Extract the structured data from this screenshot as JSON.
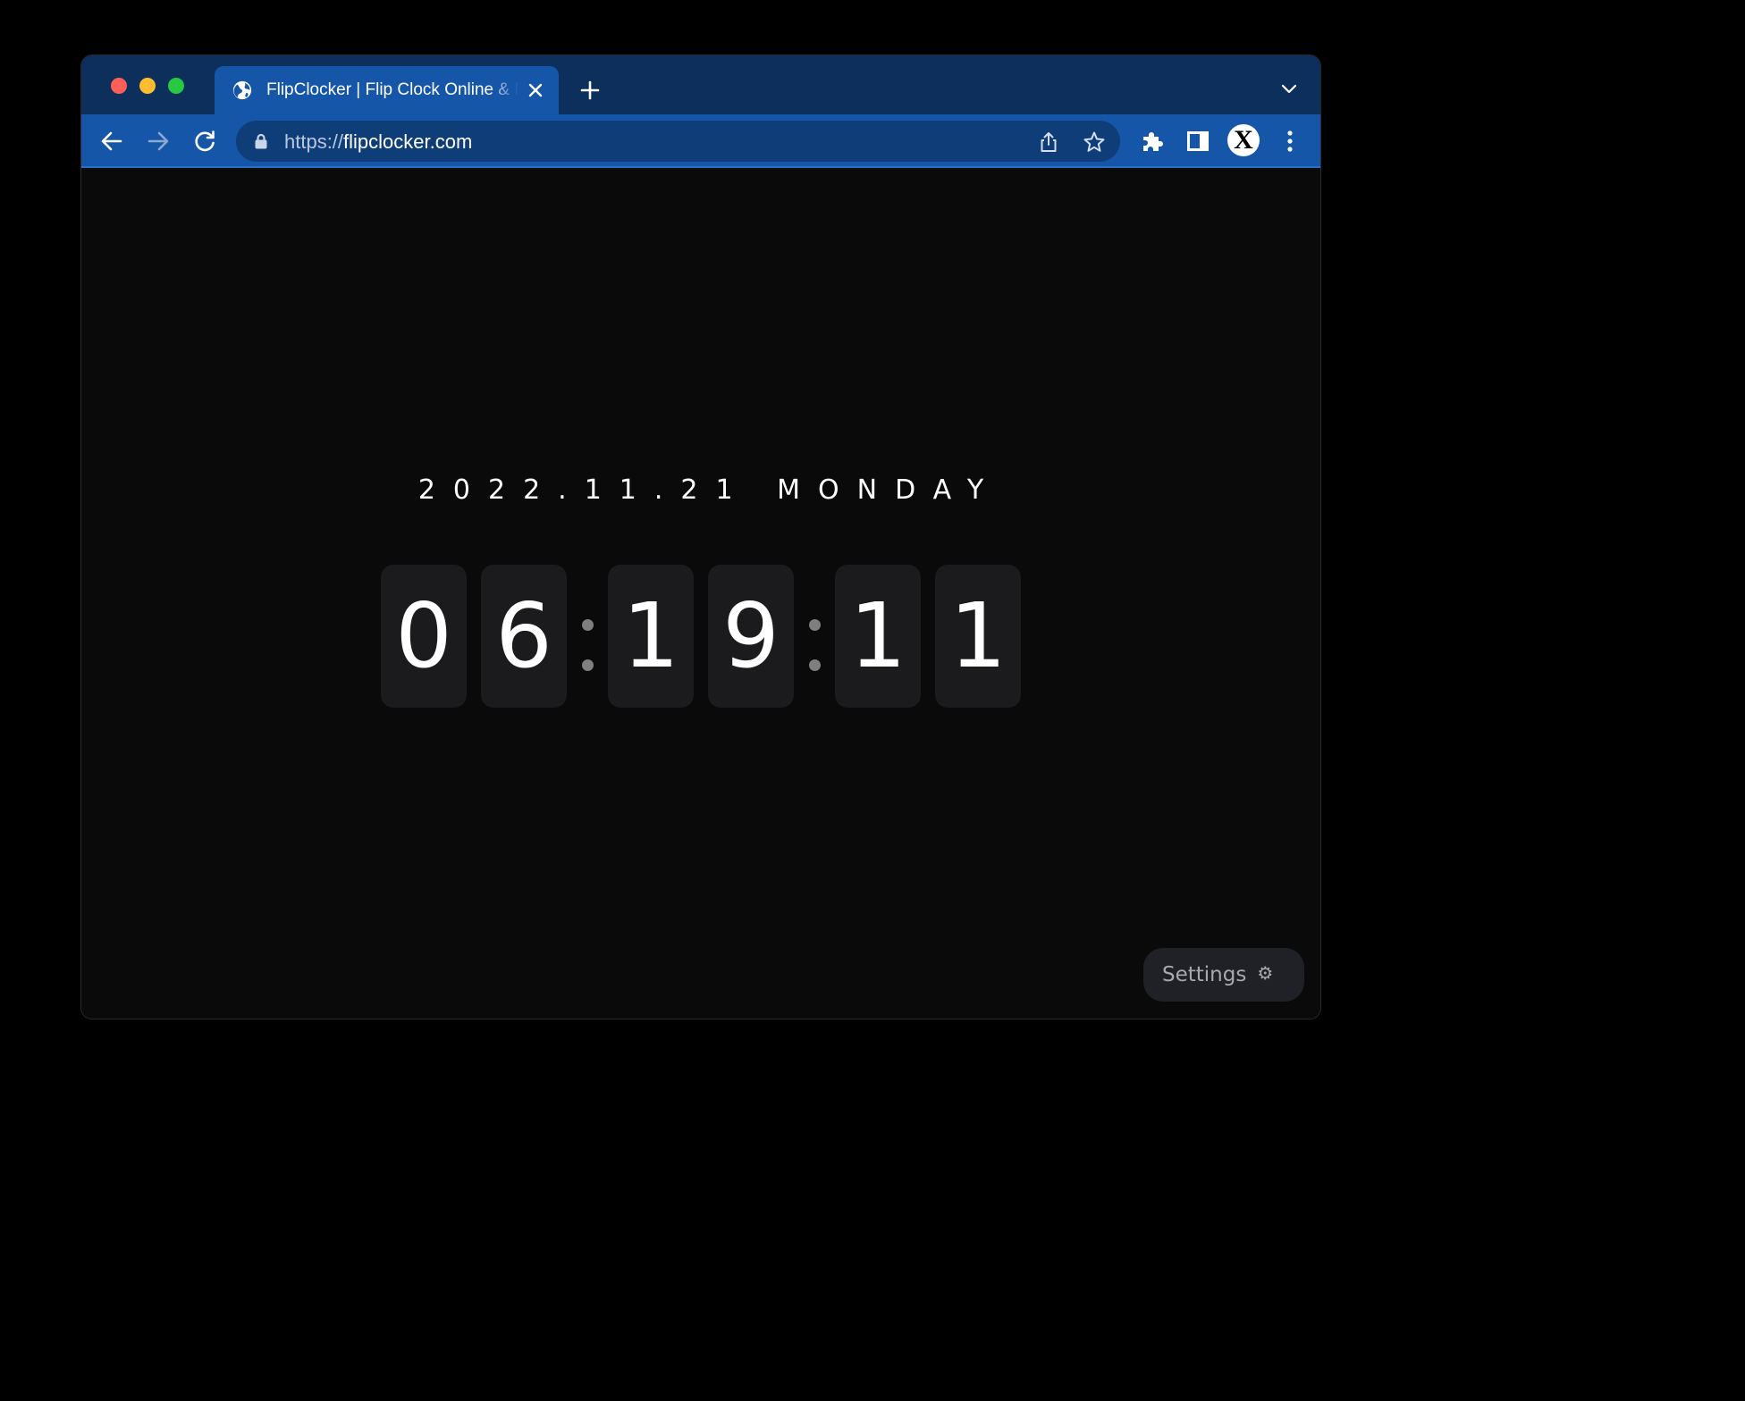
{
  "browser": {
    "tab_title": "FlipClocker | Flip Clock Online & Full Screen",
    "url_scheme": "https://",
    "url_host": "flipclocker.com",
    "profile_initial": "X",
    "colors": {
      "titlebar": "#0c2f5c",
      "toolbar": "#1656a8",
      "omnibox": "#0e3d78"
    }
  },
  "clock": {
    "date": "2022.11.21 MONDAY",
    "hour_tens": "0",
    "hour_ones": "6",
    "minute_tens": "1",
    "minute_ones": "9",
    "second_tens": "1",
    "second_ones": "1"
  },
  "settings": {
    "label": "Settings",
    "icon": "⚙"
  }
}
